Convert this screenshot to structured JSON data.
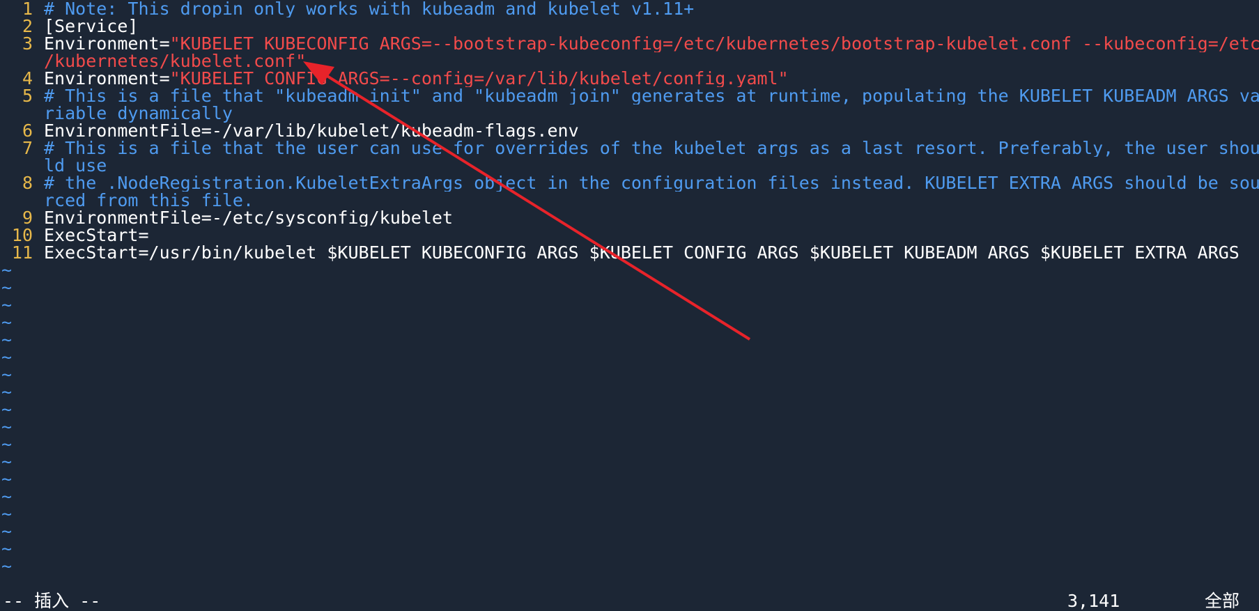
{
  "editor": {
    "lines": [
      {
        "num": "1",
        "parts": [
          {
            "cls": "cmt",
            "text": "# Note: This dropin only works with kubeadm and kubelet v1.11+"
          }
        ]
      },
      {
        "num": "2",
        "parts": [
          {
            "cls": "plain",
            "text": "[Service]"
          }
        ]
      },
      {
        "num": "3",
        "parts": [
          {
            "cls": "plain",
            "text": "Environment="
          },
          {
            "cls": "str",
            "text": "\"KUBELET_KUBECONFIG_ARGS=--bootstrap-kubeconfig=/etc/kubernetes/bootstrap-kubelet.conf --kubeconfig=/etc"
          }
        ],
        "cont": [
          {
            "cls": "str",
            "text": "/kubernetes/kubelet.conf\""
          }
        ]
      },
      {
        "num": "4",
        "parts": [
          {
            "cls": "plain",
            "text": "Environment="
          },
          {
            "cls": "str",
            "text": "\"KUBELET_CONFIG_ARGS=--config=/var/lib/kubelet/config.yaml\""
          }
        ]
      },
      {
        "num": "5",
        "parts": [
          {
            "cls": "cmt",
            "text": "# This is a file that \"kubeadm init\" and \"kubeadm join\" generates at runtime, populating the KUBELET_KUBEADM_ARGS va"
          }
        ],
        "cont": [
          {
            "cls": "cmt",
            "text": "riable dynamically"
          }
        ]
      },
      {
        "num": "6",
        "parts": [
          {
            "cls": "plain",
            "text": "EnvironmentFile=-/var/lib/kubelet/kubeadm-flags.env"
          }
        ]
      },
      {
        "num": "7",
        "parts": [
          {
            "cls": "cmt",
            "text": "# This is a file that the user can use for overrides of the kubelet args as a last resort. Preferably, the user shou"
          }
        ],
        "cont": [
          {
            "cls": "cmt",
            "text": "ld use"
          }
        ]
      },
      {
        "num": "8",
        "parts": [
          {
            "cls": "cmt",
            "text": "# the .NodeRegistration.KubeletExtraArgs object in the configuration files instead. KUBELET_EXTRA_ARGS should be sou"
          }
        ],
        "cont": [
          {
            "cls": "cmt",
            "text": "rced from this file."
          }
        ]
      },
      {
        "num": "9",
        "parts": [
          {
            "cls": "plain",
            "text": "EnvironmentFile=-/etc/sysconfig/kubelet"
          }
        ]
      },
      {
        "num": "10",
        "parts": [
          {
            "cls": "plain",
            "text": "ExecStart="
          }
        ]
      },
      {
        "num": "11",
        "parts": [
          {
            "cls": "plain",
            "text": "ExecStart=/usr/bin/kubelet $KUBELET_KUBECONFIG_ARGS $KUBELET_CONFIG_ARGS $KUBELET_KUBEADM_ARGS $KUBELET_EXTRA_ARGS"
          }
        ]
      }
    ],
    "empty_line_marker": "~",
    "empty_line_count": 18
  },
  "status_bar": {
    "mode": "-- 插入 --",
    "cursor_position": "3,141",
    "scroll": "全部"
  },
  "colors": {
    "background": "#1c2635",
    "line_number": "#e7b84a",
    "comment": "#4f9bf0",
    "string": "#f24b4b",
    "text": "#ffffff",
    "annotation_arrow": "#e8232a"
  }
}
